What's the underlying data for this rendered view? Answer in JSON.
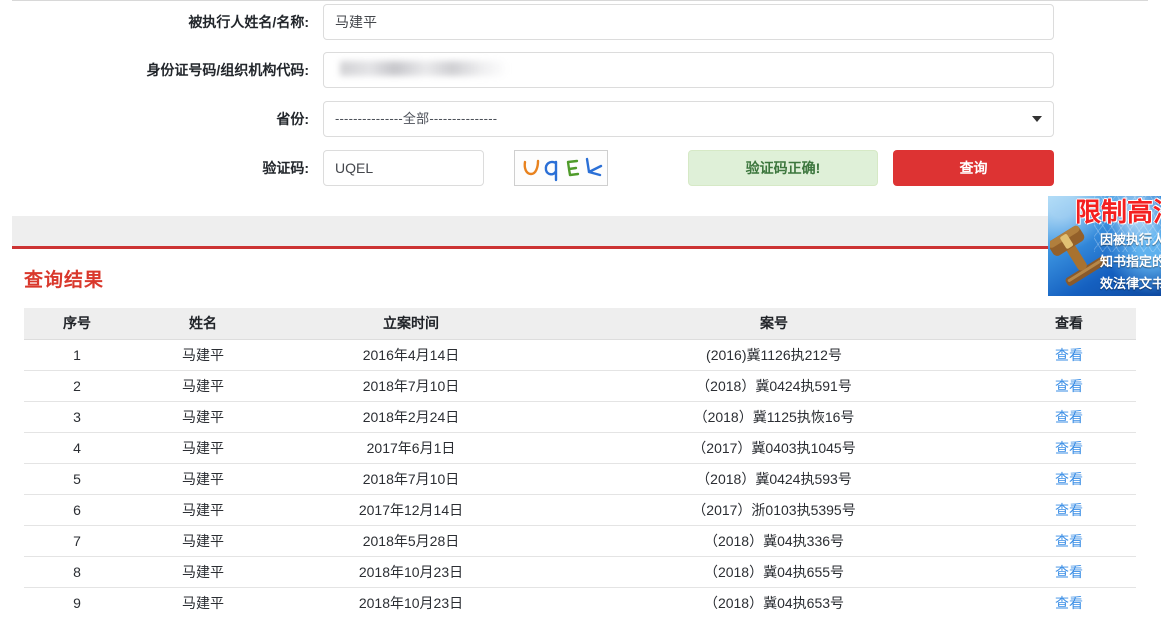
{
  "form": {
    "fields": [
      {
        "label": "被执行人姓名/名称:",
        "value": "马建平",
        "placeholder": ""
      },
      {
        "label": "身份证号码/组织机构代码:",
        "value": "",
        "placeholder": ""
      },
      {
        "label": "省份:",
        "value": "---------------全部---------------"
      },
      {
        "label": "验证码:",
        "value": "UQEL",
        "placeholder": ""
      }
    ],
    "captcha_text": "UQEL",
    "captcha_status": "验证码正确!",
    "submit_label": "查询"
  },
  "results": {
    "title": "查询结果",
    "columns": [
      "序号",
      "姓名",
      "立案时间",
      "案号",
      "查看"
    ],
    "view_label": "查看",
    "rows": [
      {
        "index": "1",
        "name": "马建平",
        "date": "2016年4月14日",
        "case_no": "(2016)冀1126执212号"
      },
      {
        "index": "2",
        "name": "马建平",
        "date": "2018年7月10日",
        "case_no": "（2018）冀0424执591号"
      },
      {
        "index": "3",
        "name": "马建平",
        "date": "2018年2月24日",
        "case_no": "（2018）冀1125执恢16号"
      },
      {
        "index": "4",
        "name": "马建平",
        "date": "2017年6月1日",
        "case_no": "（2017）冀0403执1045号"
      },
      {
        "index": "5",
        "name": "马建平",
        "date": "2018年7月10日",
        "case_no": "（2018）冀0424执593号"
      },
      {
        "index": "6",
        "name": "马建平",
        "date": "2017年12月14日",
        "case_no": "（2017）浙0103执5395号"
      },
      {
        "index": "7",
        "name": "马建平",
        "date": "2018年5月28日",
        "case_no": "（2018）冀04执336号"
      },
      {
        "index": "8",
        "name": "马建平",
        "date": "2018年10月23日",
        "case_no": "（2018）冀04执655号"
      },
      {
        "index": "9",
        "name": "马建平",
        "date": "2018年10月23日",
        "case_no": "（2018）冀04执653号"
      }
    ]
  },
  "ad": {
    "title": "限制高消",
    "line1": "因被执行人",
    "line2": "知书指定的",
    "line3": "效法律文书"
  },
  "colors": {
    "accent_red": "#dd3333",
    "title_red": "#d9382c",
    "panel_border_red": "#cc3333",
    "success_bg": "#dff0d8",
    "success_text": "#3c763d",
    "link_blue": "#3a8ee6",
    "gutter_gray": "#eeeeee"
  }
}
